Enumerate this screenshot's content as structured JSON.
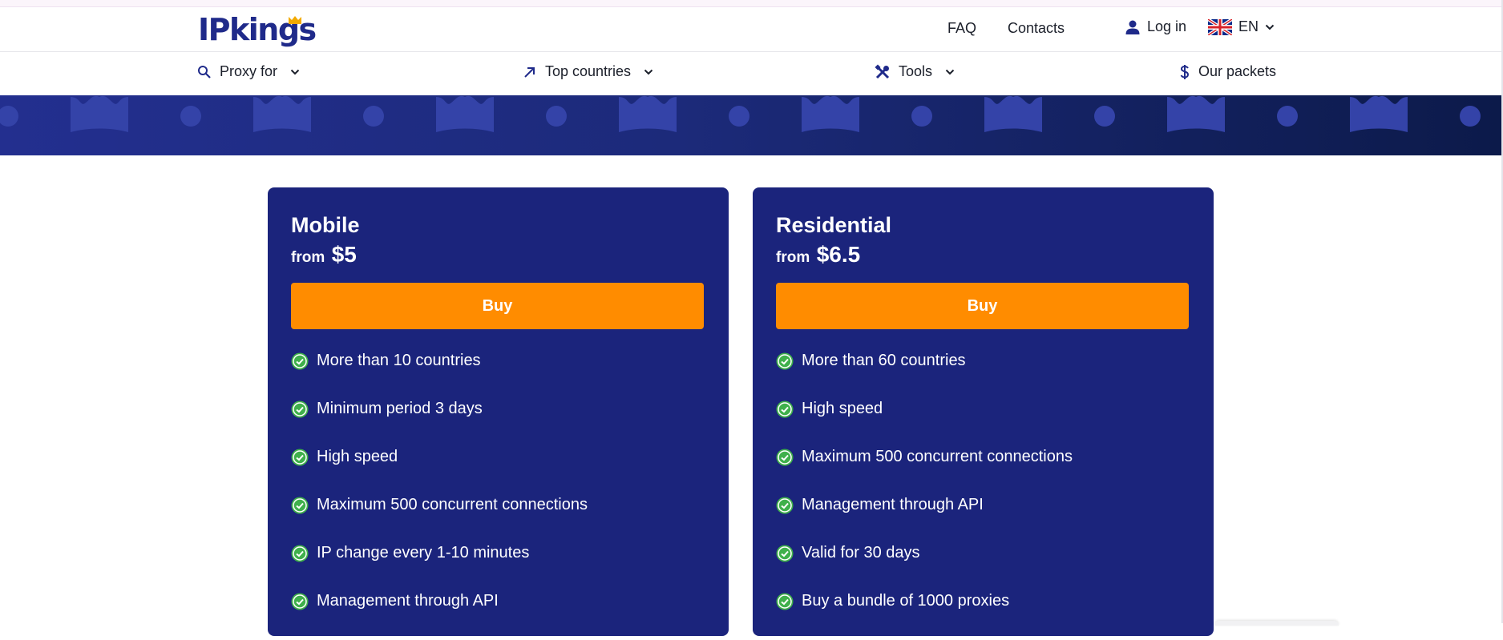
{
  "header": {
    "logo_text": "IPkings",
    "links": {
      "faq": "FAQ",
      "contacts": "Contacts"
    },
    "login_label": "Log in",
    "language": "EN"
  },
  "nav": {
    "items": [
      {
        "label": "Proxy for",
        "icon": "search-icon"
      },
      {
        "label": "Top countries",
        "icon": "arrow-up-right-icon"
      },
      {
        "label": "Tools",
        "icon": "tools-icon"
      },
      {
        "label": "Our packets",
        "icon": "dollar-icon"
      }
    ]
  },
  "colors": {
    "brand": "#1f2a8a",
    "card_bg": "#1b247c",
    "button": "#ff8c00",
    "check": "#3fb04b"
  },
  "cards": [
    {
      "title": "Mobile",
      "price_prefix": "from",
      "price": "$5",
      "button_label": "Buy",
      "features": [
        "More than 10 countries",
        "Minimum period 3 days",
        "High speed",
        "Maximum 500 concurrent connections",
        "IP change every 1-10 minutes",
        "Management through API"
      ]
    },
    {
      "title": "Residential",
      "price_prefix": "from",
      "price": "$6.5",
      "button_label": "Buy",
      "features": [
        "More than 60 countries",
        "High speed",
        "Maximum 500 concurrent connections",
        "Management through API",
        "Valid for 30 days",
        "Buy a bundle of 1000 proxies"
      ]
    }
  ]
}
